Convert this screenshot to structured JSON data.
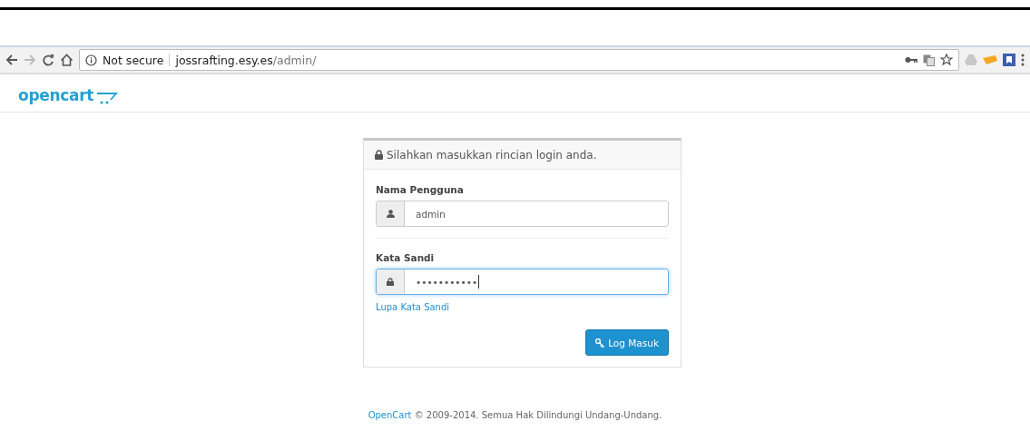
{
  "browser": {
    "security": "Not secure",
    "url_host": "jossrafting.esy.es",
    "url_path": "/admin/"
  },
  "logo": {
    "text": "opencart"
  },
  "login": {
    "heading": "Silahkan masukkan rincian login anda.",
    "fields": [
      {
        "kind": "user",
        "label": "Nama Pengguna",
        "value": "admin",
        "focused": false
      },
      {
        "kind": "password",
        "label": "Kata Sandi",
        "value": "•••••••••••",
        "focused": true
      }
    ],
    "forgot_link": "Lupa Kata Sandi",
    "submit": "Log Masuk"
  },
  "footer": {
    "link": "OpenCart",
    "text": "© 2009-2014. Semua Hak Dilindungi Undang-Undang."
  }
}
